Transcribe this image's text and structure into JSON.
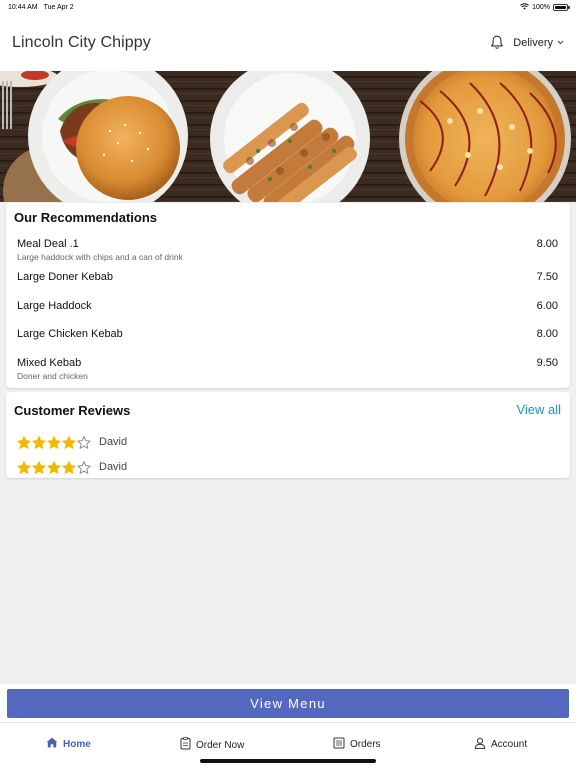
{
  "status_bar": {
    "time": "10:44 AM",
    "date": "Tue Apr 2",
    "battery": "100%"
  },
  "header": {
    "title": "Lincoln City Chippy",
    "delivery_label": "Delivery"
  },
  "recommendations": {
    "title": "Our Recommendations",
    "items": [
      {
        "name": "Meal Deal .1",
        "desc": "Large haddock with chips and a can of drink",
        "price": "8.00"
      },
      {
        "name": "Large Doner Kebab",
        "desc": "",
        "price": "7.50"
      },
      {
        "name": "Large Haddock",
        "desc": "",
        "price": "6.00"
      },
      {
        "name": "Large Chicken Kebab",
        "desc": "",
        "price": "8.00"
      },
      {
        "name": "Mixed Kebab",
        "desc": "Doner and chicken",
        "price": "9.50"
      }
    ]
  },
  "reviews": {
    "title": "Customer Reviews",
    "view_all": "View all",
    "items": [
      {
        "name": "David",
        "rating": 4,
        "out_of": 5
      },
      {
        "name": "David",
        "rating": 4,
        "out_of": 5
      }
    ]
  },
  "view_menu_button": "View Menu",
  "tabs": [
    {
      "label": "Home",
      "icon": "home-icon",
      "active": true
    },
    {
      "label": "Order Now",
      "icon": "order-icon",
      "active": false
    },
    {
      "label": "Orders",
      "icon": "orders-icon",
      "active": false
    },
    {
      "label": "Account",
      "icon": "account-icon",
      "active": false
    }
  ],
  "colors": {
    "accent": "#5468bf",
    "link": "#1a95b8",
    "star": "#f5b800",
    "active_tab": "#4a5fb3"
  }
}
